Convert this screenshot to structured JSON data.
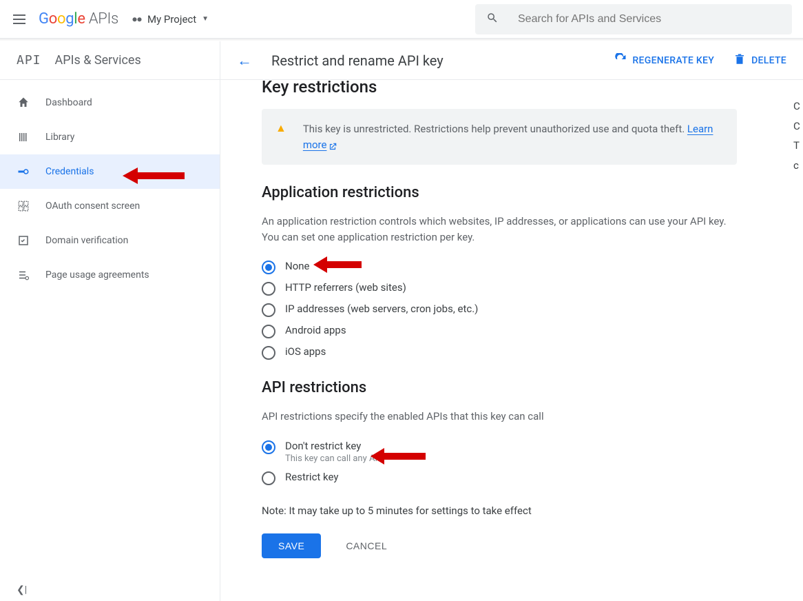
{
  "topbar": {
    "logo_apis": "APIs",
    "project_label": "My Project",
    "search_placeholder": "Search for APIs and Services"
  },
  "header": {
    "title": "Restrict and rename API key",
    "regenerate": "REGENERATE KEY",
    "delete": "DELETE"
  },
  "sidebar": {
    "title": "APIs & Services",
    "items": [
      {
        "label": "Dashboard"
      },
      {
        "label": "Library"
      },
      {
        "label": "Credentials"
      },
      {
        "label": "OAuth consent screen"
      },
      {
        "label": "Domain verification"
      },
      {
        "label": "Page usage agreements"
      }
    ]
  },
  "key_restrictions": {
    "heading": "Key restrictions",
    "warning_text": "This key is unrestricted. Restrictions help prevent unauthorized use and quota theft. ",
    "learn_more": "Learn more"
  },
  "app_restrictions": {
    "heading": "Application restrictions",
    "description": "An application restriction controls which websites, IP addresses, or applications can use your API key. You can set one application restriction per key.",
    "options": [
      {
        "label": "None"
      },
      {
        "label": "HTTP referrers (web sites)"
      },
      {
        "label": "IP addresses (web servers, cron jobs, etc.)"
      },
      {
        "label": "Android apps"
      },
      {
        "label": "iOS apps"
      }
    ]
  },
  "api_restrictions": {
    "heading": "API restrictions",
    "description": "API restrictions specify the enabled APIs that this key can call",
    "options": [
      {
        "label": "Don't restrict key",
        "sub": "This key can call any API"
      },
      {
        "label": "Restrict key"
      }
    ]
  },
  "note": "Note: It may take up to 5 minutes for settings to take effect",
  "buttons": {
    "save": "SAVE",
    "cancel": "CANCEL"
  },
  "rightclip": [
    "C",
    "C",
    "T",
    "c"
  ]
}
